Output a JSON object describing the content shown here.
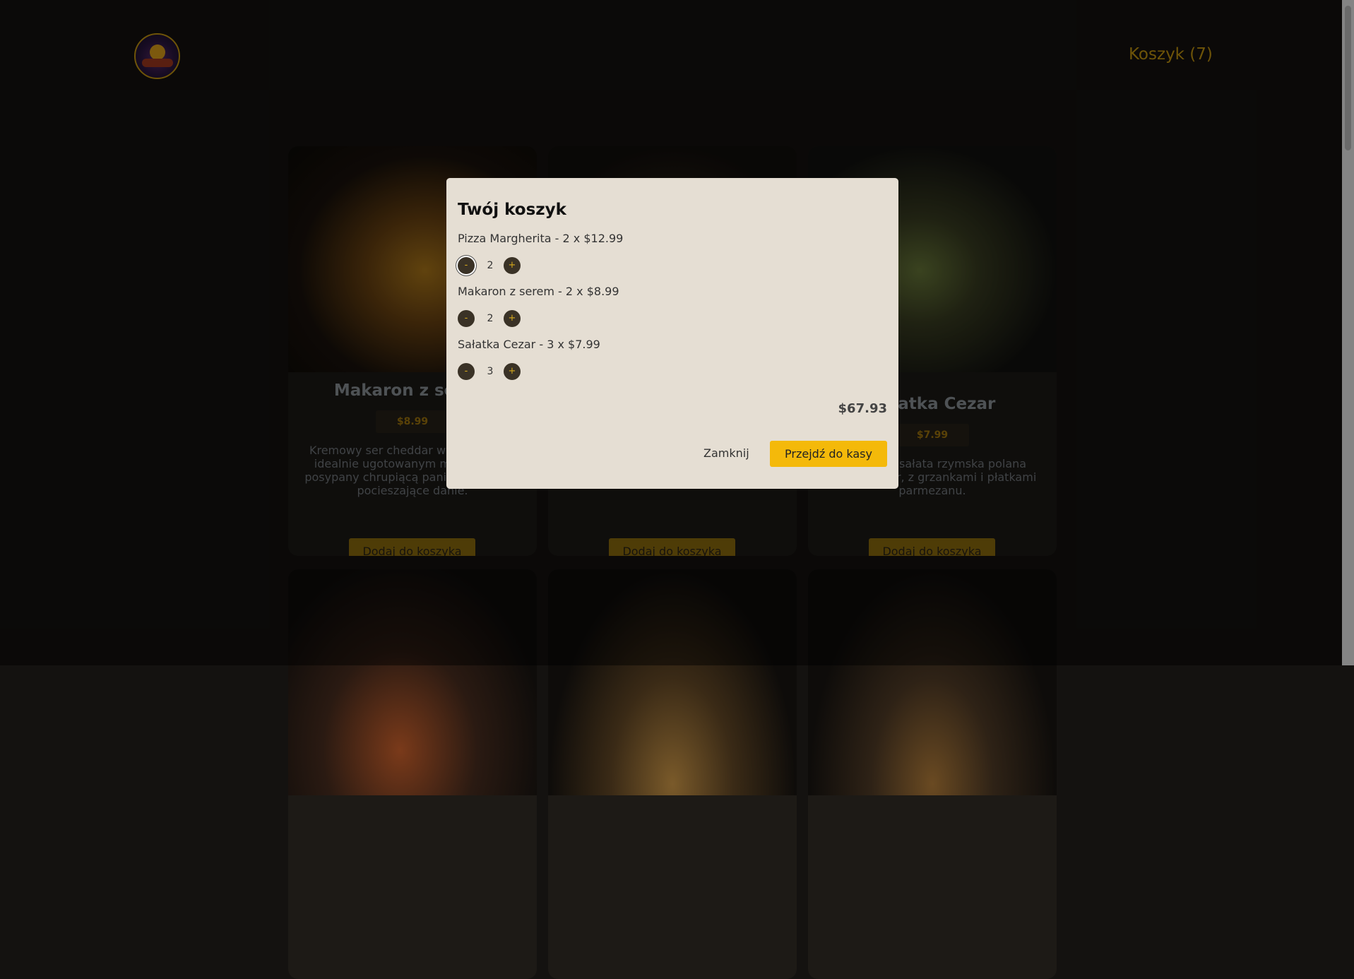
{
  "header": {
    "cart_label": "Koszyk (7)"
  },
  "cards": [
    {
      "title": "Makaron z serem",
      "price": "$8.99",
      "description": "Kremowy ser cheddar wymieszany z idealnie ugotowanym makaronem, posypany chrupiącą panierką. Idealne pocieszające danie.",
      "add_label": "Dodaj do koszyka"
    },
    {
      "title": "",
      "price": "",
      "description": "",
      "add_label": "Dodaj do koszyka"
    },
    {
      "title": "Sałatka Cezar",
      "price": "$7.99",
      "description": "Chrupiąca sałata rzymska polana sosem Cezar, z grzankami i płatkami parmezanu.",
      "add_label": "Dodaj do koszyka"
    }
  ],
  "modal": {
    "title": "Twój koszyk",
    "items": [
      {
        "label": "Pizza Margherita - 2 x $12.99",
        "qty": "2",
        "minus": "-",
        "plus": "+"
      },
      {
        "label": "Makaron z serem - 2 x $8.99",
        "qty": "2",
        "minus": "-",
        "plus": "+"
      },
      {
        "label": "Sałatka Cezar - 3 x $7.99",
        "qty": "3",
        "minus": "-",
        "plus": "+"
      }
    ],
    "total": "$67.93",
    "close_label": "Zamknij",
    "checkout_label": "Przejdź do kasy"
  }
}
